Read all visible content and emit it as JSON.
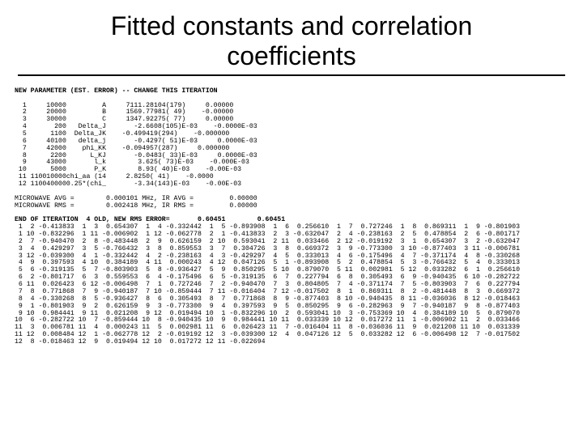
{
  "title": "Fitted constants and correlation coefficients",
  "header_line": "NEW PARAMETER (EST. ERROR) -- CHANGE THIS ITERATION",
  "param_rows": [
    {
      "n": " 1",
      "col2": "     10000",
      "name": "         A",
      "val": "     7111.28104(179)",
      "chg": "     0.00000"
    },
    {
      "n": " 2",
      "col2": "     20000",
      "name": "         B",
      "val": "     1569.77981( 49)",
      "chg": "    -0.00000"
    },
    {
      "n": " 3",
      "col2": "     30000",
      "name": "         C",
      "val": "     1347.92275( 77)",
      "chg": "     0.00000"
    },
    {
      "n": " 4",
      "col2": "       200",
      "name": "   Delta_J",
      "val": "       -2.6608(105)E-03",
      "chg": "    -0.0000E-03"
    },
    {
      "n": " 5",
      "col2": "      1100",
      "name": "  Delta_JK",
      "val": "    -0.499419(294)",
      "chg": "    -0.000000"
    },
    {
      "n": " 6",
      "col2": "     40100",
      "name": "   delta_j",
      "val": "       -0.4297( 51)E-03",
      "chg": "     0.0000E-03"
    },
    {
      "n": " 7",
      "col2": "     42000",
      "name": "    phi_KK",
      "val": "    -0.094957(287)",
      "chg": "     0.000000"
    },
    {
      "n": " 8",
      "col2": "      2200",
      "name": "      L_KJ",
      "val": "       -0.0483( 33)E-03",
      "chg": "     0.0000E-03"
    },
    {
      "n": " 9",
      "col2": "     43000",
      "name": "       l_k",
      "val": "        3.625( 73)E-03",
      "chg": "    -0.000E-03"
    },
    {
      "n": "10",
      "col2": "      5000",
      "name": "       P_K",
      "val": "        8.93( 40)E-03",
      "chg": "    -0.00E-03"
    },
    {
      "n": "11",
      "col2": " 110010000",
      "name": "chi_aa (14",
      "val": "     2.8250( 41)",
      "chg": "    -0.0000"
    },
    {
      "n": "12",
      "col2": " 110040000",
      "name": "0.25*(chi_",
      "val": "       -3.34(143)E-03",
      "chg": "    -0.00E-03"
    }
  ],
  "mw_rows": [
    "MICROWAVE AVG =        0.000101 MHz, IR AVG =         0.00000",
    "MICROWAVE RMS =        0.002418 MHz, IR RMS =         0.00000"
  ],
  "footer_line": "END OF ITERATION  4 OLD, NEW RMS ERROR=       0.60451        0.60451",
  "corr_rows": [
    " 1  2 -0.413833  1  3  0.654307  1  4 -0.332442  1  5 -0.893908  1  6  0.256610  1  7  0.727246  1  8  0.869311  1  9 -0.801903",
    " 1 10 -0.832296  1 11 -0.006902  1 12 -0.062778  2  1 -0.413833  2  3 -0.632047  2  4 -0.238163  2  5  0.478854  2  6 -0.801717",
    " 2  7 -0.940470  2  8 -0.483448  2  9  0.626159  2 10  0.593041  2 11  0.033466  2 12 -0.019192  3  1  0.654307  3  2 -0.632047",
    " 3  4  0.429297  3  5 -0.766432  3  8  0.859553  3  7  0.304726  3  8  0.669372  3  9 -0.773300  3 10 -0.877403  3 11 -0.006781",
    " 3 12 -0.039300  4  1 -0.332442  4  2 -0.238163  4  3 -0.429297  4  5  0.333013  4  6 -0.175496  4  7 -0.371174  4  8 -0.330268",
    " 4  9  0.397593  4 10  0.384189  4 11  0.000243  4 12  0.047126  5  1 -0.893908  5  2  0.478854  5  3 -0.766432  5  4  0.333013",
    " 5  6 -0.319135  5  7 -0.803903  5  8 -0.936427  5  9  0.850295  5 10  0.879070  5 11  0.002981  5 12  0.033282  6  1  0.256610",
    " 6  2 -0.801717  6  3  0.559553  6  4 -0.175496  6  5 -0.319135  6  7  0.227794  6  8  0.305493  6  9 -0.940435  6 10 -0.282722",
    " 6 11  0.026423  6 12 -0.006498  7  1  0.727246  7  2 -0.940470  7  3  0.804805  7  4 -0.371174  7  5 -0.803903  7  6  0.227794",
    " 7  8  0.771868  7  9 -0.940187  7 10 -0.859444  7 11 -0.016404  7 12 -0.017502  8  1  0.869311  8  2 -0.481448  8  3  0.669372",
    " 8  4 -0.330268  8  5 -0.936427  8  6  0.305493  8  7  0.771868  8  9 -0.877403  8 10 -0.940435  8 11 -0.036036  8 12 -0.018463",
    " 9  1 -0.801903  9  2  0.626159  9  3 -0.773300  9  4  0.397593  9  5  0.850295  9  6 -0.282963  9  7 -0.940187  9  8 -0.877403",
    " 9 10  0.984441  9 11  0.021208  9 12  0.019494 10  1 -0.832296 10  2  0.593041 10  3 -0.753369 10  4  0.384189 10  5  0.879070",
    "10  6 -0.282722 10  7 -0.859444 10  8 -0.940435 10  9  0.984441 10 11  0.033339 10 12  0.017272 11  1 -0.006902 11  2  0.033466",
    "11  3  0.006781 11  4  0.000243 11  5  0.002981 11  6  0.026423 11  7 -0.016404 11  8 -0.036036 11  9  0.021208 11 10  0.031339",
    "11 12  0.008484 12  1 -0.062778 12  2 -0.019192 12  3 -0.039300 12  4  0.047126 12  5  0.033282 12  6 -0.006498 12  7 -0.017502",
    "12  8 -0.018463 12  9  0.019494 12 10  0.017272 12 11 -0.022694"
  ]
}
